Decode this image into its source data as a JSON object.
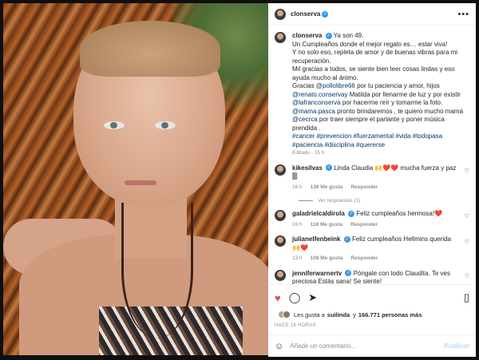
{
  "post": {
    "username": "clonserva",
    "verified_mark": "✓",
    "more_icon": "more-horizontal-icon"
  },
  "caption": {
    "username": "clonserva",
    "line1": "Ya son 49.",
    "line2": "Un Cumpleaños donde el mejor regalo es… estar viva!",
    "line3": "Y no solo eso, repleta de amor y de buenas vibras para mi recuperación.",
    "line4": "Mil gracias a todos, se siente bien leer cosas lindas y eso ayuda mucho al ánimo.",
    "gracias": "Gracias",
    "mention1": "@pollolibre66",
    "text_a": "por tu paciencia y amor, hijos",
    "mention2": "@renato.conservay",
    "text_b": "Matilda por llenarme de luz y por existir",
    "mention3": "@lafranconserva",
    "text_c": "por hacerme reír y tomarme la foto.",
    "mention4": "@mama.pasca",
    "text_d": "pronto brindaremos , te quiero mucho mamá",
    "mention5": "@cecrca",
    "text_e": "por traer siempre el parlante y poner música prendida .",
    "hashtags": "#cancer #prevencion #fuerzamental #vida #todopasa #paciencia #disciplina #quererse",
    "edited": "Editado · 15 h"
  },
  "comments": [
    {
      "username": "kikesilvas",
      "text": "Linda Claudia 🙌❤️❤️ mucha fuerza y paz 🀫",
      "time": "16 h",
      "likes": "136 Me gusta",
      "reply": "Responder"
    },
    {
      "username": "galadrielcaldirola",
      "text": "Feliz cumpleaños hermosa!❤️",
      "time": "16 h",
      "likes": "118 Me gusta",
      "reply": "Responder"
    },
    {
      "username": "julianelfenbeink",
      "text": "Feliz cumpleaños Hellmins querida 🙌❤️",
      "time": "13 h",
      "likes": "108 Me gusta",
      "reply": "Responder"
    },
    {
      "username": "jenniferwarnertv",
      "text": "Póngale con todo Claudita. Te ves preciosa Estás sana! Se siente!",
      "time": "",
      "likes": "",
      "reply": ""
    }
  ],
  "replies_label": "Ver respuestas (1)",
  "likes_line": {
    "prefix": "Les gusta a",
    "user": "suilinda",
    "middle": "y",
    "count": "166.771 personas más"
  },
  "time_ago": "HACE 16 HORAS",
  "add_comment": {
    "placeholder": "Añade un comentario...",
    "post_label": "Publicar"
  },
  "colors": {
    "link": "#00376b",
    "accent": "#3897f0",
    "like": "#ed4956"
  }
}
